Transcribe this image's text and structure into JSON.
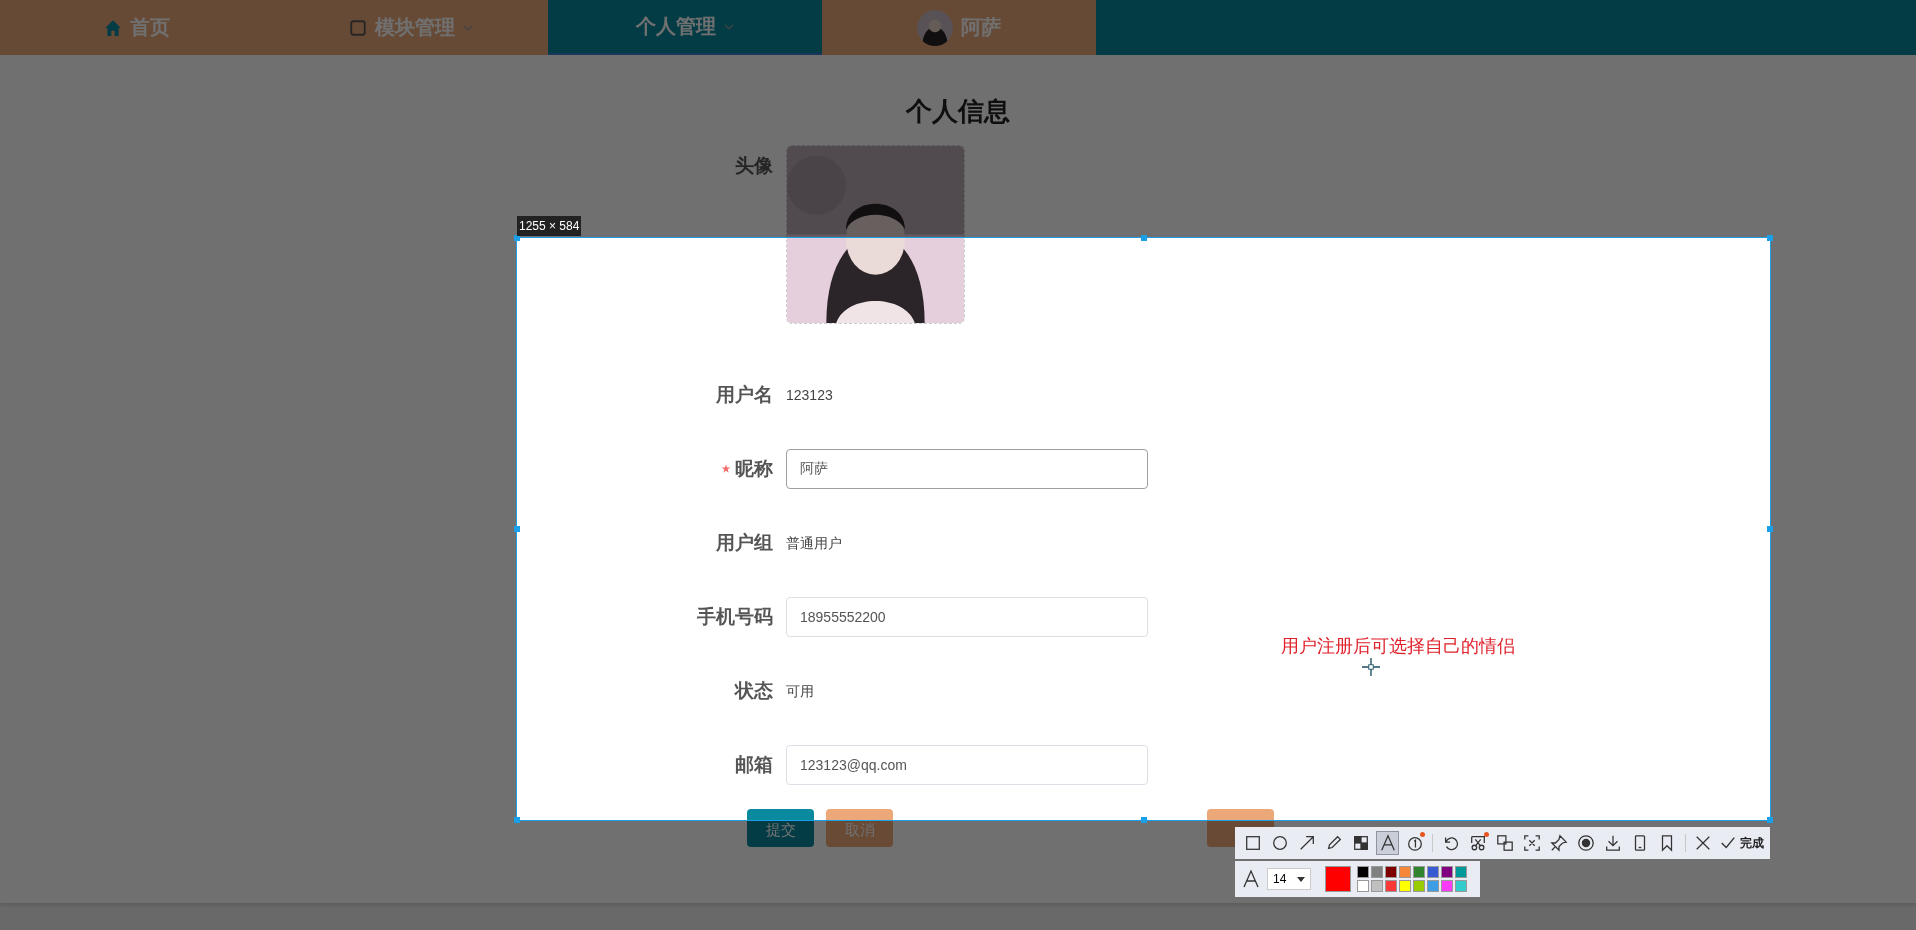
{
  "nav": [
    {
      "label": "首页",
      "kind": "home",
      "selected": false,
      "dropdown": false
    },
    {
      "label": "模块管理",
      "kind": "module",
      "selected": false,
      "dropdown": true
    },
    {
      "label": "个人管理",
      "kind": "plain",
      "selected": true,
      "dropdown": true
    },
    {
      "label": "阿萨",
      "kind": "user",
      "selected": false,
      "dropdown": false
    }
  ],
  "title": "个人信息",
  "form": [
    {
      "label": "头像",
      "kind": "avatar",
      "required": false
    },
    {
      "label": "用户名",
      "kind": "text",
      "value": "123123",
      "required": false
    },
    {
      "label": "昵称",
      "kind": "input",
      "value": "阿萨",
      "required": true,
      "focused": true
    },
    {
      "label": "用户组",
      "kind": "text",
      "value": "普通用户",
      "required": false
    },
    {
      "label": "手机号码",
      "kind": "input",
      "value": "18955552200",
      "required": false,
      "focused": false
    },
    {
      "label": "状态",
      "kind": "text",
      "value": "可用",
      "required": false
    },
    {
      "label": "邮箱",
      "kind": "input",
      "value": "123123@qq.com",
      "required": false,
      "focused": false
    }
  ],
  "buttons": [
    {
      "label": "提交",
      "kind": "primary"
    },
    {
      "label": "取消",
      "kind": "secondary"
    }
  ],
  "extra_button": {
    "kind": "secondary"
  },
  "capture": {
    "size_label": "1255 × 584",
    "annotation": "用户注册后可选择自己的情侣",
    "tools": [
      {
        "kind": "rect",
        "selected": false,
        "dot": false
      },
      {
        "kind": "ellipse",
        "selected": false,
        "dot": false
      },
      {
        "kind": "arrow",
        "selected": false,
        "dot": false
      },
      {
        "kind": "pencil",
        "selected": false,
        "dot": false
      },
      {
        "kind": "mosaic",
        "selected": false,
        "dot": false
      },
      {
        "kind": "text",
        "selected": true,
        "dot": false
      },
      {
        "kind": "number",
        "selected": false,
        "dot": true
      },
      {
        "kind": "sep"
      },
      {
        "kind": "undo",
        "selected": false,
        "dot": false
      },
      {
        "kind": "scissors",
        "selected": false,
        "dot": true
      },
      {
        "kind": "translate",
        "selected": false,
        "dot": false
      },
      {
        "kind": "scan",
        "selected": false,
        "dot": false
      },
      {
        "kind": "pin",
        "selected": false,
        "dot": false
      },
      {
        "kind": "record",
        "selected": false,
        "dot": false
      },
      {
        "kind": "download",
        "selected": false,
        "dot": false
      },
      {
        "kind": "phone",
        "selected": false,
        "dot": false
      },
      {
        "kind": "bookmark",
        "selected": false,
        "dot": false
      },
      {
        "kind": "sep"
      },
      {
        "kind": "close",
        "selected": false,
        "dot": false
      },
      {
        "kind": "done",
        "label": "完成"
      }
    ],
    "font_size": "14",
    "current": {
      "color": "#ff0000"
    },
    "palette": [
      {
        "color": "#000000"
      },
      {
        "color": "#808080"
      },
      {
        "color": "#800000"
      },
      {
        "color": "#f7883a"
      },
      {
        "color": "#308430"
      },
      {
        "color": "#385ad3"
      },
      {
        "color": "#800080"
      },
      {
        "color": "#009999"
      },
      {
        "color": "#ffffff"
      },
      {
        "color": "#c0c0c0"
      },
      {
        "color": "#fb3838"
      },
      {
        "color": "#ffff00"
      },
      {
        "color": "#99cc00"
      },
      {
        "color": "#3d9ee5"
      },
      {
        "color": "#fb3bf7"
      },
      {
        "color": "#33cccc"
      }
    ]
  }
}
